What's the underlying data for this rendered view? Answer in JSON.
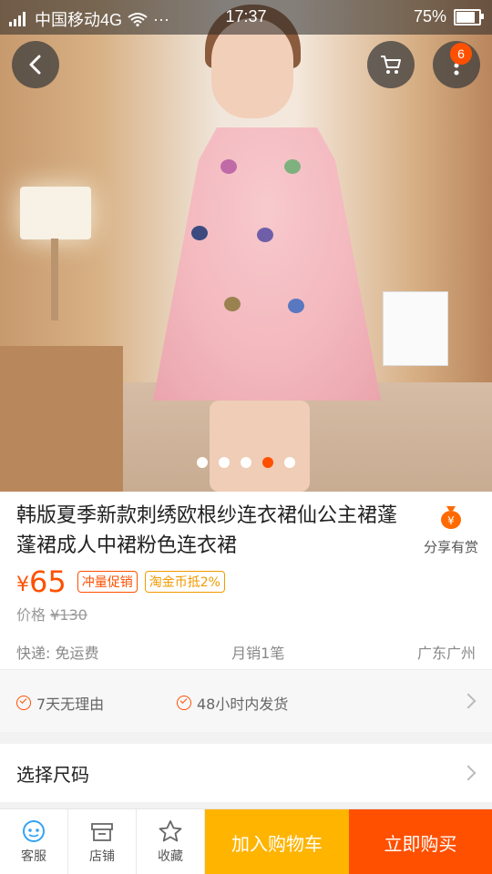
{
  "status_bar": {
    "carrier": "中国移动4G",
    "time": "17:37",
    "battery": "75%",
    "overflow": "···"
  },
  "gallery": {
    "slide_count": 5,
    "active_index": 3,
    "cart_badge": "6"
  },
  "product": {
    "title": "韩版夏季新款刺绣欧根纱连衣裙仙公主裙蓬蓬裙成人中裙粉色连衣裙",
    "share_label": "分享有赏",
    "currency": "¥",
    "price": "65",
    "tags": [
      "冲量促销",
      "淘金币抵2%"
    ],
    "original_price_label": "价格",
    "original_price": "¥130",
    "shipping": "快递: 免运费",
    "monthly_sales": "月销1笔",
    "location": "广东广州"
  },
  "guarantees": {
    "items": [
      "7天无理由",
      "48小时内发货"
    ]
  },
  "options": {
    "select_size_label": "选择尺码"
  },
  "bottom_bar": {
    "service": "客服",
    "shop": "店铺",
    "favorite": "收藏",
    "add_to_cart": "加入购物车",
    "buy_now": "立即购买"
  },
  "colors": {
    "accent": "#ff5000",
    "cart_button": "#ffb400"
  }
}
